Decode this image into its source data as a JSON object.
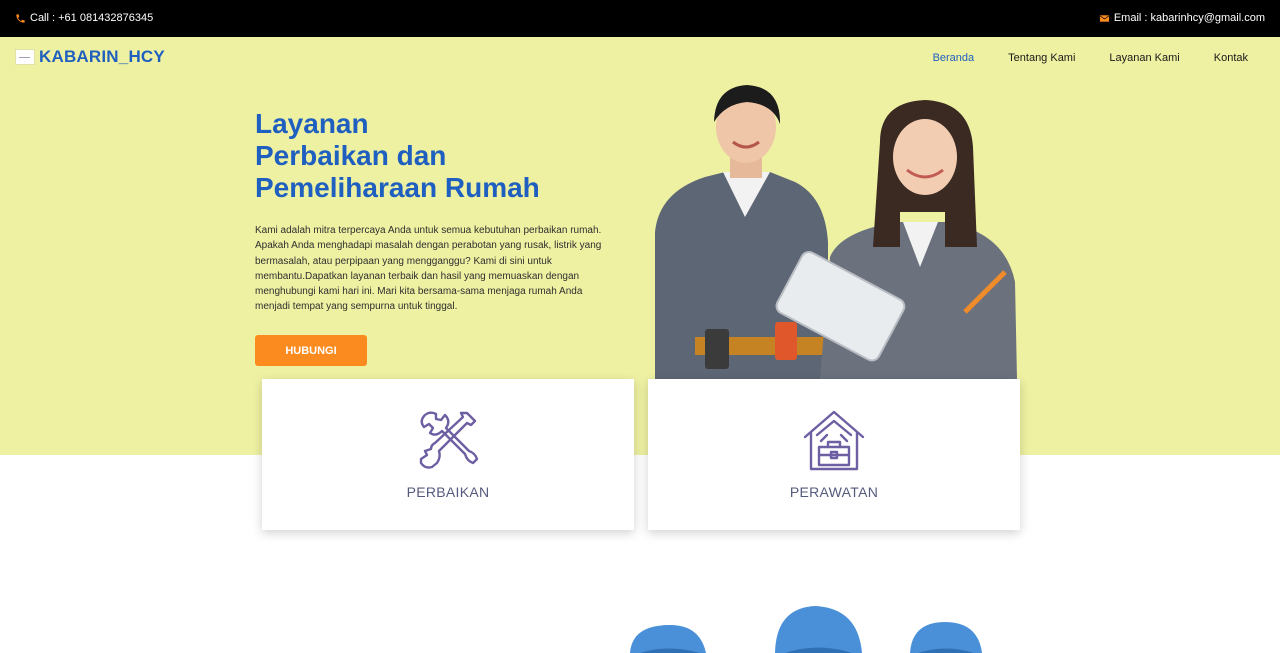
{
  "topbar": {
    "call_text": "Call : +61 081432876345",
    "email_text": "Email : kabarinhcy@gmail.com"
  },
  "brand": {
    "name": "KABARIN_HCY"
  },
  "nav": {
    "items": [
      {
        "label": "Beranda",
        "active": true
      },
      {
        "label": "Tentang Kami",
        "active": false
      },
      {
        "label": "Layanan Kami",
        "active": false
      },
      {
        "label": "Kontak",
        "active": false
      }
    ]
  },
  "hero": {
    "title_lines": [
      "Layanan",
      "Perbaikan dan",
      "Pemeliharaan Rumah"
    ],
    "description": "Kami adalah mitra terpercaya Anda untuk semua kebutuhan perbaikan rumah. Apakah Anda menghadapi masalah dengan perabotan yang rusak, listrik yang bermasalah, atau perpipaan yang mengganggu? Kami di sini untuk membantu.Dapatkan layanan terbaik dan hasil yang memuaskan dengan menghubungi kami hari ini. Mari kita bersama-sama menjaga rumah Anda menjadi tempat yang sempurna untuk tinggal.",
    "cta_label": "HUBUNGI"
  },
  "services": [
    {
      "label": "PERBAIKAN",
      "icon": "wrench-cross-icon"
    },
    {
      "label": "PERAWATAN",
      "icon": "house-toolbox-icon"
    }
  ],
  "colors": {
    "hero_bg": "#eef1a2",
    "brand_blue": "#1f5fc0",
    "accent_orange": "#fb8b1e",
    "card_text": "#555a7d"
  }
}
